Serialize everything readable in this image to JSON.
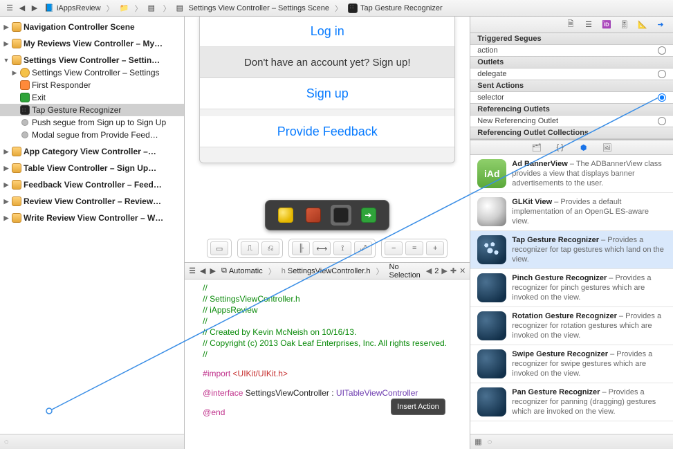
{
  "jumpbar": {
    "project": "iAppsReview",
    "scene_group": "Settings View Controller – Settings Scene",
    "object": "Tap Gesture Recognizer"
  },
  "navigator": {
    "items": [
      {
        "label": "Navigation Controller Scene",
        "level": 0,
        "tri": "▶",
        "bold": true,
        "ico": "scene"
      },
      {
        "label": "My Reviews View Controller – My…",
        "level": 0,
        "tri": "▶",
        "bold": true,
        "ico": "scene"
      },
      {
        "label": "Settings View Controller – Settin…",
        "level": 0,
        "tri": "▼",
        "bold": true,
        "ico": "scene"
      },
      {
        "label": "Settings View Controller – Settings",
        "level": 1,
        "tri": "▶",
        "ico": "vc"
      },
      {
        "label": "First Responder",
        "level": 1,
        "tri": "",
        "ico": "resp"
      },
      {
        "label": "Exit",
        "level": 1,
        "tri": "",
        "ico": "exit"
      },
      {
        "label": "Tap Gesture Recognizer",
        "level": 1,
        "tri": "",
        "ico": "tap",
        "selected": true
      },
      {
        "label": "Push segue from Sign up to Sign Up",
        "level": 1,
        "tri": "",
        "ico": "seg"
      },
      {
        "label": "Modal segue from Provide Feed…",
        "level": 1,
        "tri": "",
        "ico": "seg"
      },
      {
        "label": "App Category View Controller –…",
        "level": 0,
        "tri": "▶",
        "bold": true,
        "ico": "scene"
      },
      {
        "label": "Table View Controller – Sign Up…",
        "level": 0,
        "tri": "▶",
        "bold": true,
        "ico": "scene"
      },
      {
        "label": "Feedback View Controller – Feed…",
        "level": 0,
        "tri": "▶",
        "bold": true,
        "ico": "scene"
      },
      {
        "label": "Review View Controller – Review…",
        "level": 0,
        "tri": "▶",
        "bold": true,
        "ico": "scene"
      },
      {
        "label": "Write Review View Controller – W…",
        "level": 0,
        "tri": "▶",
        "bold": true,
        "ico": "scene"
      }
    ]
  },
  "phone": {
    "login": "Log in",
    "signup_prompt": "Don't have an account yet? Sign up!",
    "signup": "Sign up",
    "feedback": "Provide Feedback"
  },
  "codebar": {
    "mode": "Automatic",
    "file": "SettingsViewController.h",
    "selection": "No Selection",
    "counter": "2"
  },
  "code": {
    "l1": "//",
    "l2": "//  SettingsViewController.h",
    "l3": "//  iAppsReview",
    "l4": "//",
    "l5": "//  Created by Kevin McNeish on 10/16/13.",
    "l6": "//  Copyright (c) 2013 Oak Leaf Enterprises, Inc. All rights reserved.",
    "l7": "//",
    "l8a": "#import ",
    "l8b": "<UIKit/UIKit.h>",
    "l9a": "@interface",
    "l9b": " SettingsViewController : ",
    "l9c": "UITableViewController",
    "l10": "@end"
  },
  "insert_tip": "Insert Action",
  "inspector": {
    "sections": [
      {
        "head": "Triggered Segues",
        "rows": [
          {
            "label": "action",
            "linked": false
          }
        ]
      },
      {
        "head": "Outlets",
        "rows": [
          {
            "label": "delegate",
            "linked": false
          }
        ]
      },
      {
        "head": "Sent Actions",
        "rows": [
          {
            "label": "selector",
            "linked": true
          }
        ]
      },
      {
        "head": "Referencing Outlets",
        "rows": [
          {
            "label": "New Referencing Outlet",
            "linked": false
          }
        ]
      },
      {
        "head": "Referencing Outlet Collections",
        "rows": []
      }
    ]
  },
  "library": [
    {
      "title": "Ad BannerView",
      "desc": " – The ADBannerView class provides a view that displays banner advertisements to the user.",
      "cls": "lib-iad",
      "glyph": "iAd"
    },
    {
      "title": "GLKit View",
      "desc": " – Provides a default implementation of an OpenGL ES-aware view.",
      "cls": "lib-gl",
      "glyph": ""
    },
    {
      "title": "Tap Gesture Recognizer",
      "desc": " – Provides a recognizer for tap gestures which land on the view.",
      "cls": "lib-gest tap",
      "glyph": "",
      "selected": true
    },
    {
      "title": "Pinch Gesture Recognizer",
      "desc": " – Provides a recognizer for pinch gestures which are invoked on the view.",
      "cls": "lib-gest",
      "glyph": ""
    },
    {
      "title": "Rotation Gesture Recognizer",
      "desc": " – Provides a recognizer for rotation gestures which are invoked on the view.",
      "cls": "lib-gest",
      "glyph": ""
    },
    {
      "title": "Swipe Gesture Recognizer",
      "desc": " – Provides a recognizer for swipe gestures which are invoked on the view.",
      "cls": "lib-gest",
      "glyph": ""
    },
    {
      "title": "Pan Gesture Recognizer",
      "desc": " – Provides a recognizer for panning (dragging) gestures which are invoked on the view.",
      "cls": "lib-gest",
      "glyph": ""
    }
  ]
}
